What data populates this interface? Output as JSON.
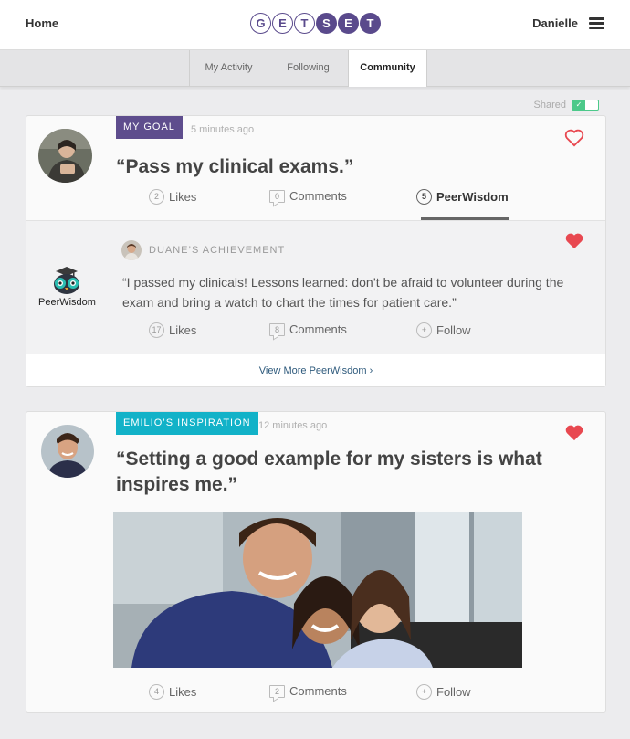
{
  "header": {
    "home_label": "Home",
    "logo_letters": [
      "G",
      "E",
      "T",
      "S",
      "E",
      "T"
    ],
    "user_name": "Danielle",
    "brand_color": "#5a4a8c"
  },
  "tabs": [
    {
      "label": "My Activity",
      "active": false
    },
    {
      "label": "Following",
      "active": false
    },
    {
      "label": "Community",
      "active": true
    }
  ],
  "shared": {
    "label": "Shared",
    "enabled": true,
    "color": "#4cc98a"
  },
  "posts": [
    {
      "tag": "MY GOAL",
      "tag_color": "#5e4d8d",
      "time": "5 minutes ago",
      "quote": "“Pass my clinical exams.”",
      "liked": false,
      "likes": "2",
      "likes_label": "Likes",
      "comments": "0",
      "comments_label": "Comments",
      "peerwisdom": "5",
      "peerwisdom_label": "PeerWisdom"
    },
    {
      "tag": "EMILIO’S INSPIRATION",
      "tag_color": "#12b2c8",
      "time": "12 minutes ago",
      "quote": "“Setting a good example for my sisters is what inspires me.”",
      "liked": true,
      "likes": "4",
      "likes_label": "Likes",
      "comments": "2",
      "comments_label": "Comments",
      "follow_label": "Follow"
    }
  ],
  "peer_wisdom": {
    "brand": "PeerWisdom",
    "achievement": "DUANE’S ACHIEVEMENT",
    "text": "“I passed my clinicals! Lessons learned: don’t be afraid to volunteer during the exam and bring a watch to chart the times for patient care.”",
    "liked": true,
    "likes": "17",
    "likes_label": "Likes",
    "comments": "8",
    "comments_label": "Comments",
    "follow_label": "Follow",
    "view_more": "View More PeerWisdom ›"
  },
  "heart_color": "#e84850"
}
